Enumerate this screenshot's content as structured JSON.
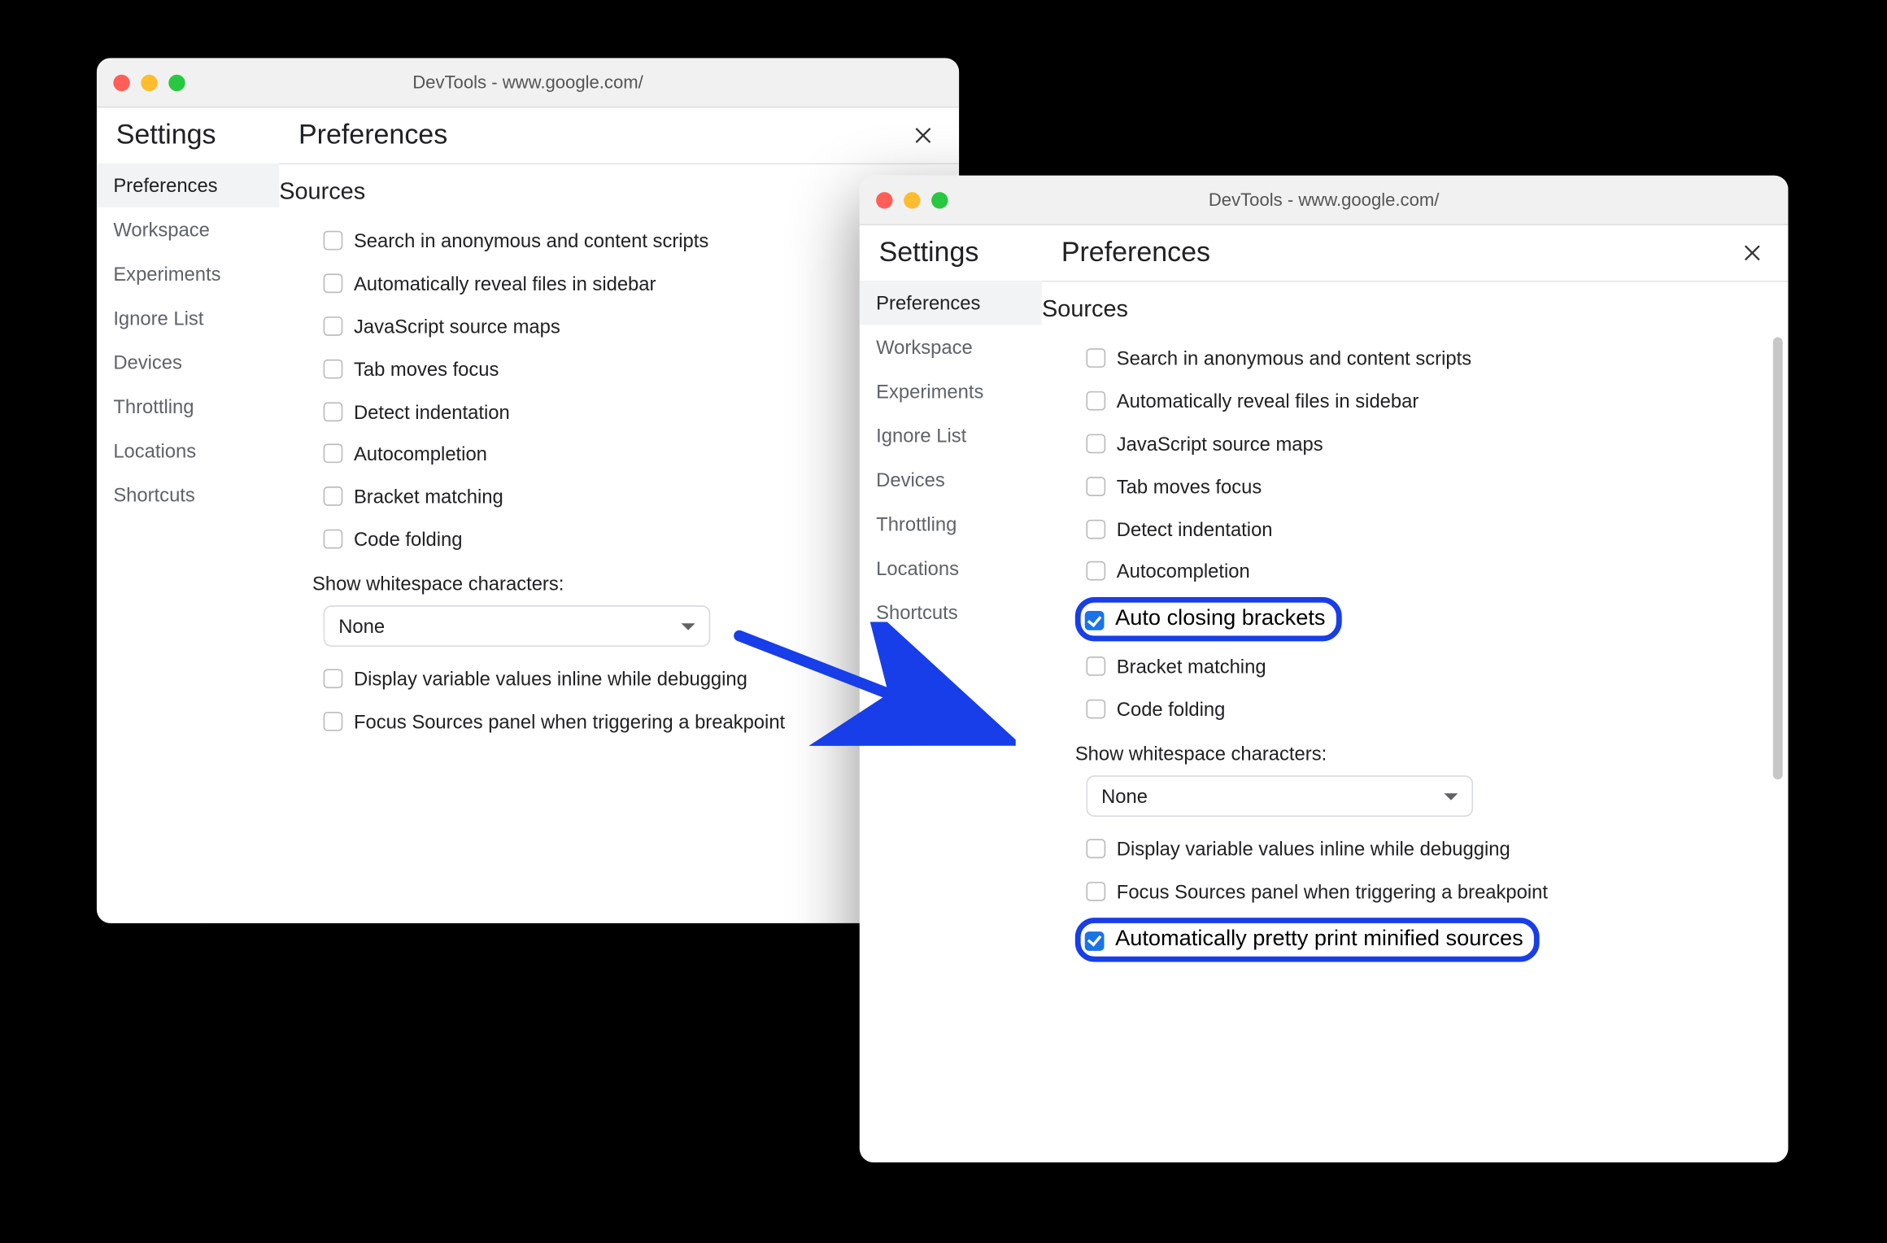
{
  "colors": {
    "highlight": "#173ee8",
    "checkboxChecked": "#1a73e8"
  },
  "window1": {
    "title": "DevTools - www.google.com/",
    "settingsLabel": "Settings",
    "heading": "Preferences",
    "sidebar": {
      "items": [
        {
          "label": "Preferences",
          "active": true
        },
        {
          "label": "Workspace",
          "active": false
        },
        {
          "label": "Experiments",
          "active": false
        },
        {
          "label": "Ignore List",
          "active": false
        },
        {
          "label": "Devices",
          "active": false
        },
        {
          "label": "Throttling",
          "active": false
        },
        {
          "label": "Locations",
          "active": false
        },
        {
          "label": "Shortcuts",
          "active": false
        }
      ]
    },
    "section": {
      "title": "Sources",
      "options": [
        {
          "label": "Search in anonymous and content scripts",
          "checked": false
        },
        {
          "label": "Automatically reveal files in sidebar",
          "checked": false
        },
        {
          "label": "JavaScript source maps",
          "checked": false
        },
        {
          "label": "Tab moves focus",
          "checked": false
        },
        {
          "label": "Detect indentation",
          "checked": false
        },
        {
          "label": "Autocompletion",
          "checked": false
        },
        {
          "label": "Bracket matching",
          "checked": false
        },
        {
          "label": "Code folding",
          "checked": false
        }
      ],
      "whitespace": {
        "label": "Show whitespace characters:",
        "value": "None"
      },
      "tail": [
        {
          "label": "Display variable values inline while debugging",
          "checked": false
        },
        {
          "label": "Focus Sources panel when triggering a breakpoint",
          "checked": false
        }
      ]
    }
  },
  "window2": {
    "title": "DevTools - www.google.com/",
    "settingsLabel": "Settings",
    "heading": "Preferences",
    "sidebar": {
      "items": [
        {
          "label": "Preferences",
          "active": true
        },
        {
          "label": "Workspace",
          "active": false
        },
        {
          "label": "Experiments",
          "active": false
        },
        {
          "label": "Ignore List",
          "active": false
        },
        {
          "label": "Devices",
          "active": false
        },
        {
          "label": "Throttling",
          "active": false
        },
        {
          "label": "Locations",
          "active": false
        },
        {
          "label": "Shortcuts",
          "active": false
        }
      ]
    },
    "section": {
      "title": "Sources",
      "options": [
        {
          "label": "Search in anonymous and content scripts",
          "checked": false,
          "highlight": false
        },
        {
          "label": "Automatically reveal files in sidebar",
          "checked": false,
          "highlight": false
        },
        {
          "label": "JavaScript source maps",
          "checked": false,
          "highlight": false
        },
        {
          "label": "Tab moves focus",
          "checked": false,
          "highlight": false
        },
        {
          "label": "Detect indentation",
          "checked": false,
          "highlight": false
        },
        {
          "label": "Autocompletion",
          "checked": false,
          "highlight": false
        },
        {
          "label": "Auto closing brackets",
          "checked": true,
          "highlight": true
        },
        {
          "label": "Bracket matching",
          "checked": false,
          "highlight": false
        },
        {
          "label": "Code folding",
          "checked": false,
          "highlight": false
        }
      ],
      "whitespace": {
        "label": "Show whitespace characters:",
        "value": "None"
      },
      "tail": [
        {
          "label": "Display variable values inline while debugging",
          "checked": false,
          "highlight": false
        },
        {
          "label": "Focus Sources panel when triggering a breakpoint",
          "checked": false,
          "highlight": false
        },
        {
          "label": "Automatically pretty print minified sources",
          "checked": true,
          "highlight": true
        }
      ]
    }
  }
}
